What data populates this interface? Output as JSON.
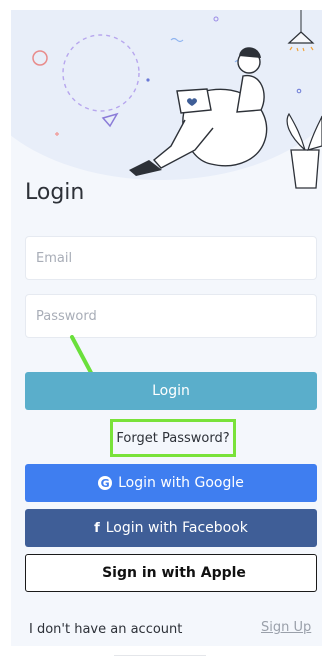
{
  "login": {
    "title": "Login",
    "email_placeholder": "Email",
    "password_placeholder": "Password",
    "login_button": "Login",
    "forget_password": "Forget Password?",
    "google_button": "Login with Google",
    "facebook_button": "Login with Facebook",
    "apple_button": "Sign in with Apple",
    "no_account_text": "I don't have an account",
    "signup_link": "Sign Up"
  },
  "icons": {
    "google": "google-icon",
    "facebook": "facebook-icon",
    "apple": "apple-icon"
  },
  "colors": {
    "login_button": "#5aaecb",
    "google_button": "#3f7ef0",
    "facebook_button": "#3f5e97",
    "highlight": "#79e23a"
  }
}
